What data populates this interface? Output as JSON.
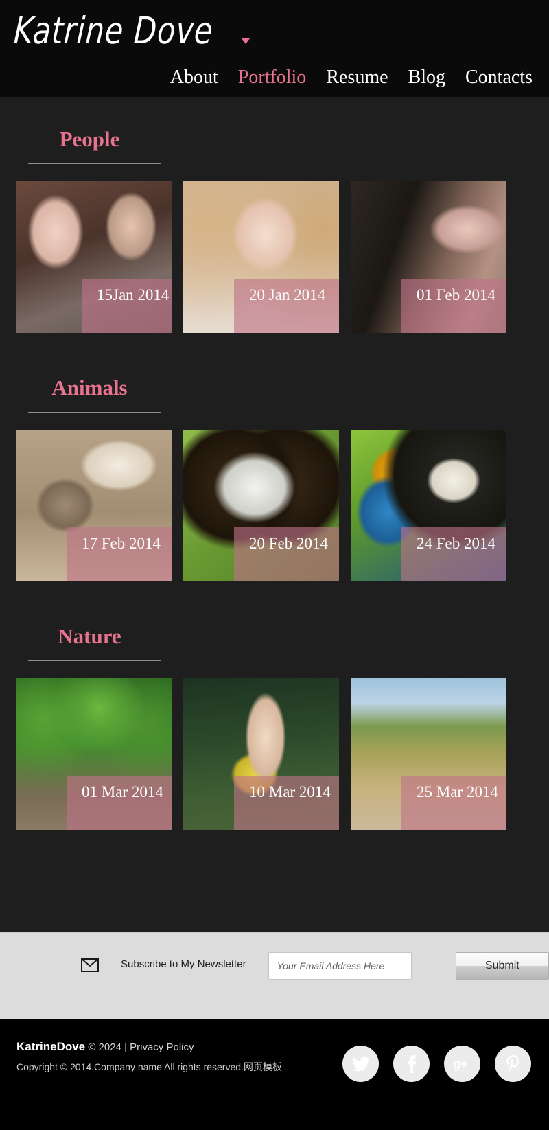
{
  "header": {
    "logo": "Katrine Dove",
    "caret_icon": "caret-down-icon",
    "nav": [
      {
        "label": "About",
        "active": false
      },
      {
        "label": "Portfolio",
        "active": true
      },
      {
        "label": "Resume",
        "active": false
      },
      {
        "label": "Blog",
        "active": false
      },
      {
        "label": "Contacts",
        "active": false
      }
    ]
  },
  "accent_color": "#e8738f",
  "background_color": "#1e1e1e",
  "sections": [
    {
      "title": "People",
      "cards": [
        {
          "date": "15Jan 2014",
          "photo": "couple-portrait"
        },
        {
          "date": "20 Jan 2014",
          "photo": "young-girl-portrait"
        },
        {
          "date": "01 Feb 2014",
          "photo": "reclining-model"
        }
      ]
    },
    {
      "title": "Animals",
      "cards": [
        {
          "date": "17 Feb 2014",
          "photo": "kitten-and-puppy"
        },
        {
          "date": "20 Feb 2014",
          "photo": "ring-tailed-lemur"
        },
        {
          "date": "24 Feb 2014",
          "photo": "blue-gold-macaw"
        }
      ]
    },
    {
      "title": "Nature",
      "cards": [
        {
          "date": "01 Mar 2014",
          "photo": "green-forest"
        },
        {
          "date": "10 Mar 2014",
          "photo": "woman-in-field"
        },
        {
          "date": "25 Mar 2014",
          "photo": "autumn-meadow"
        }
      ]
    }
  ],
  "newsletter": {
    "envelope_icon": "envelope-icon",
    "label": "Subscribe to My Newsletter",
    "placeholder": "Your Email Address Here",
    "value": "",
    "submit_label": "Submit"
  },
  "footer": {
    "brand": "KatrineDove",
    "copyright_short": "© 2024 | Privacy Policy",
    "copyright_long": "Copyright © 2014.Company name All rights reserved.网页模板",
    "socials": [
      {
        "name": "twitter-icon"
      },
      {
        "name": "facebook-icon"
      },
      {
        "name": "google-plus-icon"
      },
      {
        "name": "pinterest-icon"
      }
    ]
  }
}
